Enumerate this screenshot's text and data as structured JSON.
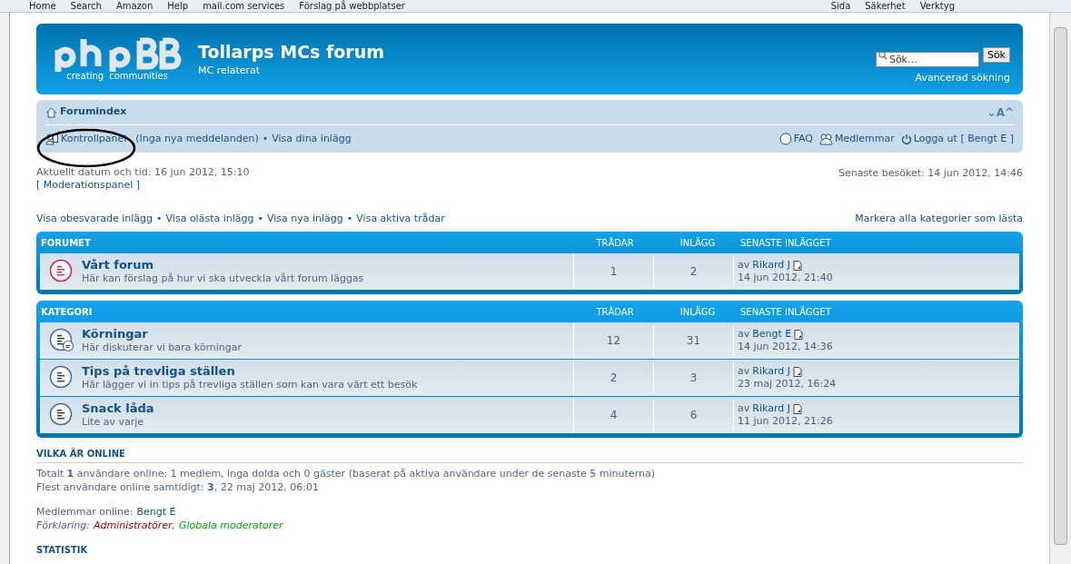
{
  "browser_toolbar": {
    "links": [
      "Home",
      "Search",
      "Amazon",
      "Help",
      "mail.com services",
      "Förslag på webbplatser"
    ],
    "menus": [
      "Sida",
      "Säkerhet",
      "Verktyg"
    ]
  },
  "header": {
    "logo_tagline": [
      "creating",
      "communities"
    ],
    "title": "Tollarps MCs forum",
    "subtitle": "MC relaterat",
    "search": {
      "placeholder": "Sök…",
      "button": "Sök",
      "advanced": "Avancerad sökning"
    }
  },
  "navbar": {
    "breadcrumb": "Forumindex",
    "font_size_control": [
      "⌄",
      "A",
      "^"
    ],
    "control_panel": "Kontrollpanel",
    "messages": "(Inga nya meddelanden)",
    "bullet": "•",
    "own_posts": "Visa dina inlägg",
    "faq": "FAQ",
    "members": "Medlemmar",
    "logout": "Logga ut [ Bengt E ]"
  },
  "info": {
    "current_time": "Aktuellt datum och tid: 16 jun 2012, 15:10",
    "moderation": "[ Moderationspanel ]",
    "last_visit": "Senaste besöket: 14 jun 2012, 14:46"
  },
  "quick_links": [
    "Visa obesvarade inlägg",
    "Visa olästa inlägg",
    "Visa nya inlägg",
    "Visa aktiva trådar"
  ],
  "link_separator": "•",
  "mark_read": "Markera alla kategorier som lästa",
  "categories": [
    {
      "title": "FORUMET",
      "columns": [
        "TRÅDAR",
        "INLÄGG",
        "SENASTE INLÄGGET"
      ],
      "forums": [
        {
          "kind": "unread",
          "name": "Vårt forum",
          "description": "Här kan förslag på hur vi ska utveckla vårt forum läggas",
          "topics": "1",
          "posts": "2",
          "by": "av",
          "author": "Rikard J",
          "time": "14 jun 2012, 21:40"
        }
      ]
    },
    {
      "title": "KATEGORI",
      "columns": [
        "TRÅDAR",
        "INLÄGG",
        "SENASTE INLÄGGET"
      ],
      "forums": [
        {
          "kind": "read_subforum",
          "name": "Körningar",
          "description": "Här diskuterar vi bara körningar",
          "topics": "12",
          "posts": "31",
          "by": "av",
          "author": "Bengt E",
          "time": "14 jun 2012, 14:36"
        },
        {
          "kind": "read",
          "name": "Tips på trevliga ställen",
          "description": "Här lägger vi in tips på trevliga ställen som kan vara värt ett besök",
          "topics": "2",
          "posts": "3",
          "by": "av",
          "author": "Rikard J",
          "time": "23 maj 2012, 16:24"
        },
        {
          "kind": "read",
          "name": "Snack låda",
          "description": "Lite av varje",
          "topics": "4",
          "posts": "6",
          "by": "av",
          "author": "Rikard J",
          "time": "11 jun 2012, 21:26"
        }
      ]
    }
  ],
  "online": {
    "heading": "VILKA ÄR ONLINE",
    "total": "Totalt **1** användare online: 1 medlem, inga dolda och 0 gäster (baserat på aktiva användare under de senaste 5 minuterna)",
    "record": "Flest användare online samtidigt: **3**, 22 maj 2012, 06:01",
    "members_label": "Medlemmar online:",
    "members": [
      "Bengt E"
    ],
    "legend_label": "Förklaring:",
    "legend_separator": ",",
    "legend": [
      {
        "name": "Administratörer",
        "color": "#aa0000"
      },
      {
        "name": "Globala moderatorer",
        "color": "#00aa00"
      }
    ]
  },
  "statistics_heading": "STATISTIK"
}
